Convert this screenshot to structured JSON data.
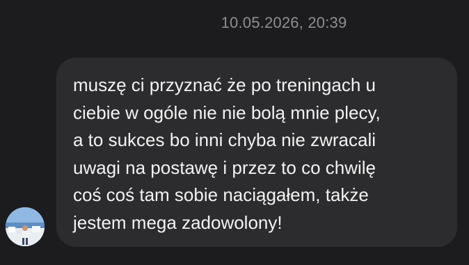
{
  "conversation": {
    "timestamp": "10.05.2026, 20:39",
    "messages": [
      {
        "sender_avatar": "avatar-photo",
        "text": "muszę ci przyznać że po treningach u\nciebie w ogóle nie nie bolą mnie plecy,\na to sukces bo inni chyba nie zwracali\nuwagi na postawę i przez to co chwilę\ncoś coś tam sobie naciągałem, także\njestem mega zadowolony!"
      }
    ]
  },
  "colors": {
    "background": "#1c1c1e",
    "bubble": "#2c2c2e",
    "timestamp_text": "#8e8e93",
    "message_text": "#f2f2f2"
  }
}
